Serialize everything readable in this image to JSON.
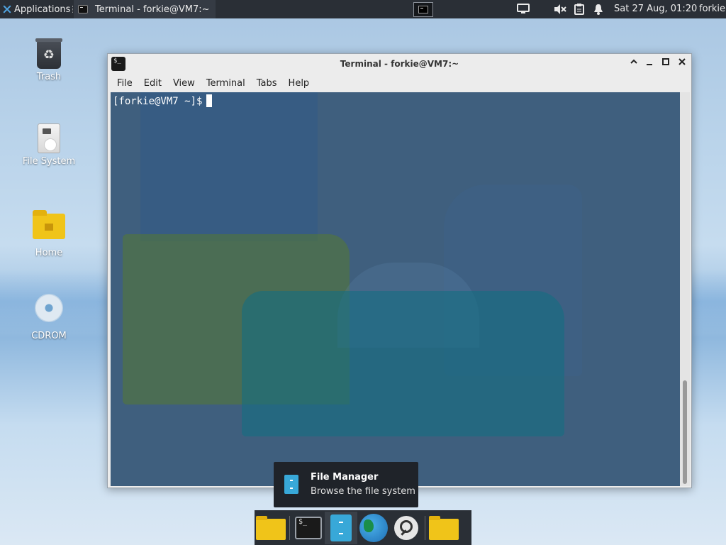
{
  "top_panel": {
    "applications_label": "Applications",
    "task_title": "Terminal - forkie@VM7:~",
    "clock": "Sat 27 Aug, 01:20",
    "user": "forkie",
    "tray_icons": [
      "display-icon",
      "volume-muted-icon",
      "clipboard-icon",
      "notification-bell-icon"
    ]
  },
  "desktop": {
    "icons": [
      {
        "label": "Trash",
        "icon": "trash-icon"
      },
      {
        "label": "File System",
        "icon": "drive-icon"
      },
      {
        "label": "Home",
        "icon": "home-folder-icon"
      },
      {
        "label": "CDROM",
        "icon": "cdrom-icon"
      }
    ]
  },
  "terminal_window": {
    "title": "Terminal - forkie@VM7:~",
    "menu": [
      "File",
      "Edit",
      "View",
      "Terminal",
      "Tabs",
      "Help"
    ],
    "prompt": "[forkie@VM7 ~]$",
    "controls": [
      "up-icon",
      "minimize-icon",
      "maximize-icon",
      "close-icon"
    ]
  },
  "tooltip": {
    "title": "File Manager",
    "subtitle": "Browse the file system"
  },
  "dock": {
    "items": [
      "Show Desktop",
      "Terminal",
      "File Manager",
      "Web Browser",
      "App Finder",
      "Folder"
    ]
  },
  "colors": {
    "panel_bg": "#2a2f36",
    "terminal_bg": "#3f5f7e",
    "folder_yellow": "#f0c419",
    "filemanager_blue": "#38a8d8"
  }
}
